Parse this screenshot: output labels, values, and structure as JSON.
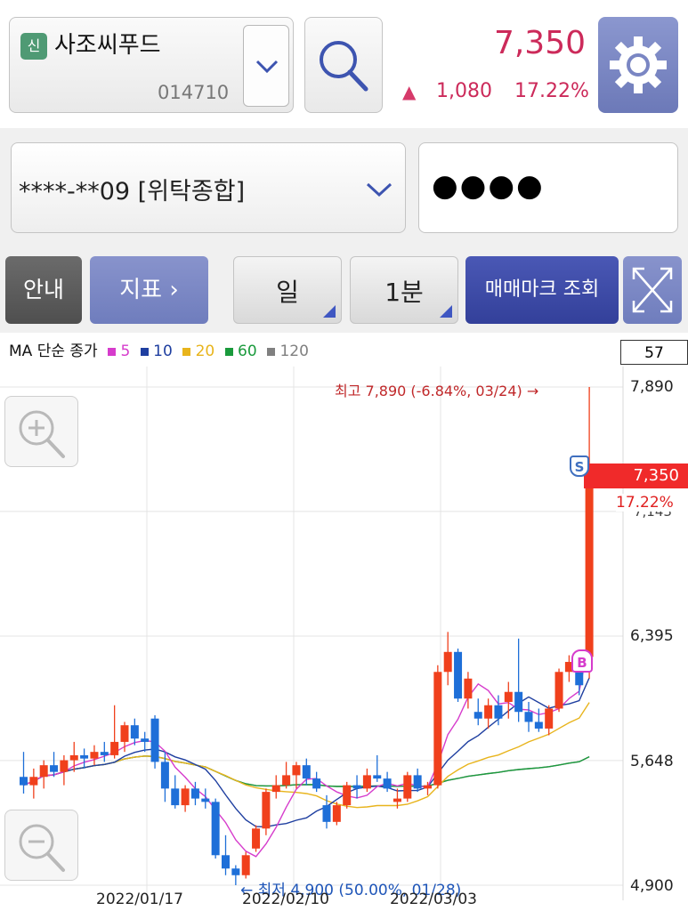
{
  "stock": {
    "badge": "신",
    "name": "사조씨푸드",
    "code": "014710",
    "price": "7,350",
    "change": "1,080",
    "change_pct": "17.22%",
    "up_arrow": "▲"
  },
  "account": {
    "number": "****-**09 [위탁종합]",
    "password_mask": "●●●●"
  },
  "toolbar": {
    "info": "안내",
    "indicator": "지표 ›",
    "period": "일",
    "interval": "1분",
    "trade_mark": "매매마크 조회"
  },
  "legend": {
    "prefix": "MA 단순 종가",
    "ma5": "5",
    "ma10": "10",
    "ma20": "20",
    "ma60": "60",
    "ma120": "120"
  },
  "chart": {
    "count": "57",
    "high_note": "최고 7,890 (-6.84%, 03/24) →",
    "low_note": "← 최저 4,900 (50.00%, 01/28)",
    "current_price": "7,350",
    "current_pct": "17.22%",
    "y_ticks": [
      "7,890",
      "7,143",
      "6,395",
      "5,648",
      "4,900"
    ],
    "x_labels": [
      "2022/01/17",
      "2022/02/10",
      "2022/03/03"
    ],
    "sell_mark": "S",
    "buy_mark": "B"
  },
  "colors": {
    "up": "#f0401c",
    "down": "#1e6fd8",
    "ma5": "#d63ccc",
    "ma10": "#1f3fa0",
    "ma20": "#e8b41c",
    "ma60": "#1a9a3c",
    "ma120": "#808080",
    "price_red": "#cc2a5a"
  },
  "icons": [
    "chevron-down-icon",
    "search-icon",
    "gear-icon",
    "expand-icon",
    "zoom-in-icon",
    "zoom-out-icon"
  ],
  "chart_data": {
    "type": "candlestick",
    "ylim": [
      4900,
      7890
    ],
    "candles": [
      [
        5550,
        5700,
        5450,
        5500
      ],
      [
        5500,
        5600,
        5420,
        5550
      ],
      [
        5550,
        5650,
        5480,
        5620
      ],
      [
        5620,
        5700,
        5550,
        5580
      ],
      [
        5580,
        5680,
        5500,
        5650
      ],
      [
        5650,
        5760,
        5580,
        5680
      ],
      [
        5680,
        5720,
        5600,
        5660
      ],
      [
        5660,
        5740,
        5620,
        5700
      ],
      [
        5700,
        5760,
        5640,
        5680
      ],
      [
        5680,
        5980,
        5660,
        5760
      ],
      [
        5760,
        5880,
        5700,
        5860
      ],
      [
        5860,
        5900,
        5740,
        5780
      ],
      [
        5780,
        5820,
        5700,
        5760
      ],
      [
        5900,
        5920,
        5600,
        5640
      ],
      [
        5640,
        5700,
        5400,
        5480
      ],
      [
        5480,
        5560,
        5360,
        5380
      ],
      [
        5380,
        5500,
        5340,
        5480
      ],
      [
        5480,
        5520,
        5380,
        5420
      ],
      [
        5420,
        5480,
        5360,
        5400
      ],
      [
        5400,
        5420,
        5060,
        5080
      ],
      [
        5080,
        5200,
        4960,
        5000
      ],
      [
        5000,
        5020,
        4900,
        4960
      ],
      [
        4960,
        5100,
        4940,
        5080
      ],
      [
        5120,
        5260,
        5100,
        5240
      ],
      [
        5240,
        5480,
        5200,
        5460
      ],
      [
        5460,
        5560,
        5420,
        5500
      ],
      [
        5500,
        5640,
        5480,
        5560
      ],
      [
        5560,
        5640,
        5480,
        5620
      ],
      [
        5620,
        5660,
        5500,
        5540
      ],
      [
        5540,
        5580,
        5460,
        5480
      ],
      [
        5380,
        5440,
        5240,
        5280
      ],
      [
        5280,
        5400,
        5260,
        5380
      ],
      [
        5380,
        5520,
        5360,
        5500
      ],
      [
        5500,
        5560,
        5420,
        5480
      ],
      [
        5480,
        5600,
        5460,
        5560
      ],
      [
        5560,
        5680,
        5520,
        5540
      ],
      [
        5540,
        5580,
        5460,
        5480
      ],
      [
        5400,
        5480,
        5360,
        5420
      ],
      [
        5420,
        5580,
        5400,
        5560
      ],
      [
        5560,
        5600,
        5460,
        5480
      ],
      [
        5480,
        5520,
        5440,
        5500
      ],
      [
        5500,
        6220,
        5480,
        6180
      ],
      [
        6180,
        6420,
        6100,
        6300
      ],
      [
        6300,
        6320,
        6000,
        6020
      ],
      [
        6020,
        6180,
        5960,
        6140
      ],
      [
        5940,
        6020,
        5860,
        5900
      ],
      [
        5900,
        6020,
        5840,
        5980
      ],
      [
        5980,
        6040,
        5860,
        5900
      ],
      [
        6000,
        6120,
        5900,
        6060
      ],
      [
        6060,
        6380,
        5880,
        5940
      ],
      [
        5940,
        6000,
        5820,
        5880
      ],
      [
        5880,
        5960,
        5820,
        5840
      ],
      [
        5840,
        5980,
        5800,
        5960
      ],
      [
        5960,
        6200,
        5940,
        6180
      ],
      [
        6180,
        6280,
        6120,
        6240
      ],
      [
        6240,
        6220,
        6040,
        6100
      ],
      [
        6270,
        7890,
        6140,
        7350
      ]
    ]
  }
}
